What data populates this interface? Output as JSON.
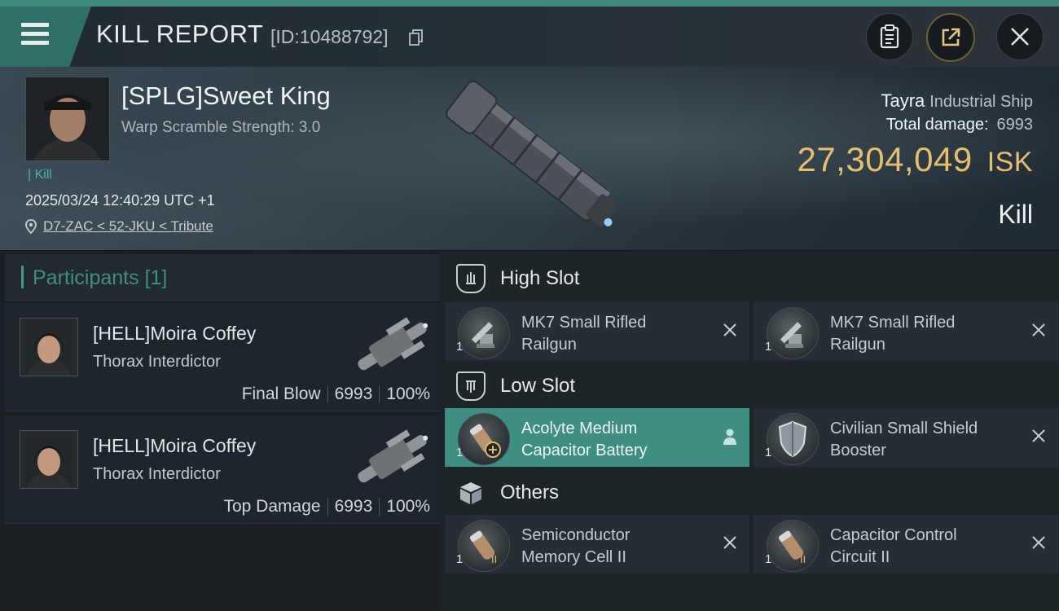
{
  "header": {
    "title": "KILL REPORT",
    "report_id": "[ID:10488792]"
  },
  "victim": {
    "name": "[SPLG]Sweet King",
    "warp_scramble": "Warp Scramble Strength: 3.0",
    "kill_tag": "Kill",
    "datetime": "2025/03/24 12:40:29 UTC +1",
    "location": "D7-ZAC < 52-JKU < Tribute"
  },
  "summary": {
    "ship_name": "Tayra",
    "ship_class": "Industrial Ship",
    "damage_label": "Total damage:",
    "damage_value": "6993",
    "isk_value": "27,304,049",
    "isk_unit": "ISK",
    "result": "Kill"
  },
  "participants": {
    "title": "Participants",
    "count": "[1]",
    "rows": [
      {
        "name": "[HELL]Moira Coffey",
        "ship": "Thorax Interdictor",
        "tag": "Final Blow",
        "damage": "6993",
        "percent": "100%"
      },
      {
        "name": "[HELL]Moira Coffey",
        "ship": "Thorax Interdictor",
        "tag": "Top Damage",
        "damage": "6993",
        "percent": "100%"
      }
    ]
  },
  "slots": {
    "high": {
      "label": "High Slot",
      "items": [
        {
          "name_line1": "MK7 Small Rifled",
          "name_line2": "Railgun",
          "qty": "1"
        },
        {
          "name_line1": "MK7 Small Rifled",
          "name_line2": "Railgun",
          "qty": "1"
        }
      ]
    },
    "low": {
      "label": "Low Slot",
      "items": [
        {
          "name_line1": "Acolyte Medium",
          "name_line2": "Capacitor Battery",
          "qty": "1"
        },
        {
          "name_line1": "Civilian Small Shield",
          "name_line2": "Booster",
          "qty": "1"
        }
      ]
    },
    "others": {
      "label": "Others",
      "items": [
        {
          "name_line1": "Semiconductor",
          "name_line2": "Memory Cell II",
          "qty": "1"
        },
        {
          "name_line1": "Capacitor Control",
          "name_line2": "Circuit II",
          "qty": "1"
        }
      ]
    }
  },
  "colors": {
    "accent": "#3e8e82",
    "isk": "#e3bf6f",
    "background": "#1c2227"
  },
  "icons": [
    "menu-icon",
    "copy-icon",
    "clipboard-icon",
    "share-icon",
    "close-icon",
    "location-pin-icon",
    "high-slot-icon",
    "low-slot-icon",
    "cube-icon",
    "remove-icon",
    "person-icon"
  ]
}
